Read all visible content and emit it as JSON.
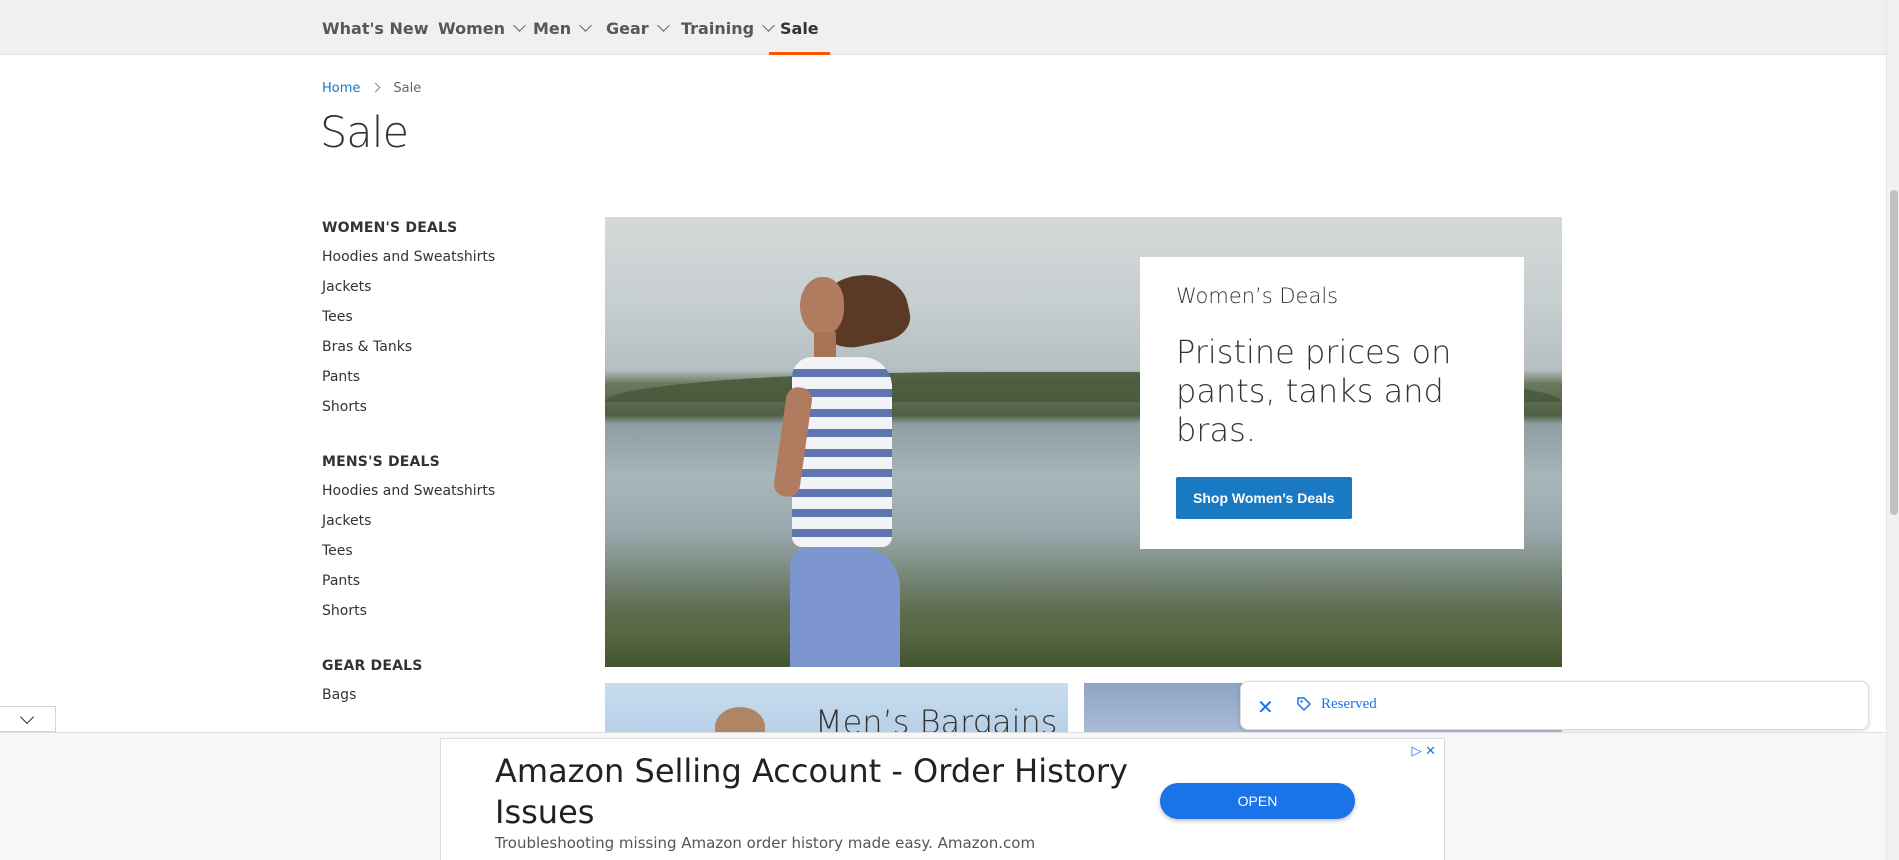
{
  "nav": {
    "items": [
      {
        "label": "What's New",
        "dropdown": false
      },
      {
        "label": "Women",
        "dropdown": true
      },
      {
        "label": "Men",
        "dropdown": true
      },
      {
        "label": "Gear",
        "dropdown": true
      },
      {
        "label": "Training",
        "dropdown": true
      },
      {
        "label": "Sale",
        "dropdown": false,
        "active": true
      }
    ]
  },
  "breadcrumb": {
    "home": "Home",
    "current": "Sale"
  },
  "page_title": "Sale",
  "sidebar": {
    "groups": [
      {
        "heading": "WOMEN'S DEALS",
        "links": [
          "Hoodies and Sweatshirts",
          "Jackets",
          "Tees",
          "Bras & Tanks",
          "Pants",
          "Shorts"
        ]
      },
      {
        "heading": "MENS'S DEALS",
        "links": [
          "Hoodies and Sweatshirts",
          "Jackets",
          "Tees",
          "Pants",
          "Shorts"
        ]
      },
      {
        "heading": "GEAR DEALS",
        "links": [
          "Bags"
        ]
      }
    ]
  },
  "hero": {
    "eyebrow": "Women’s Deals",
    "headline": "Pristine prices on pants, tanks and bras.",
    "cta": "Shop Women’s Deals"
  },
  "tiles": {
    "men_title": "Men’s Bargains"
  },
  "reserved": {
    "label": "Reserved",
    "close_icon": "✕"
  },
  "ad": {
    "title": "Amazon Selling Account - Order History Issues",
    "description": "Troubleshooting missing Amazon order history made easy. Amazon.com",
    "button": "OPEN",
    "adchoices_icons": "▷ ✕"
  },
  "colors": {
    "accent": "#1979c3",
    "active_underline": "#ff5501",
    "ad_button": "#1a73e8"
  }
}
